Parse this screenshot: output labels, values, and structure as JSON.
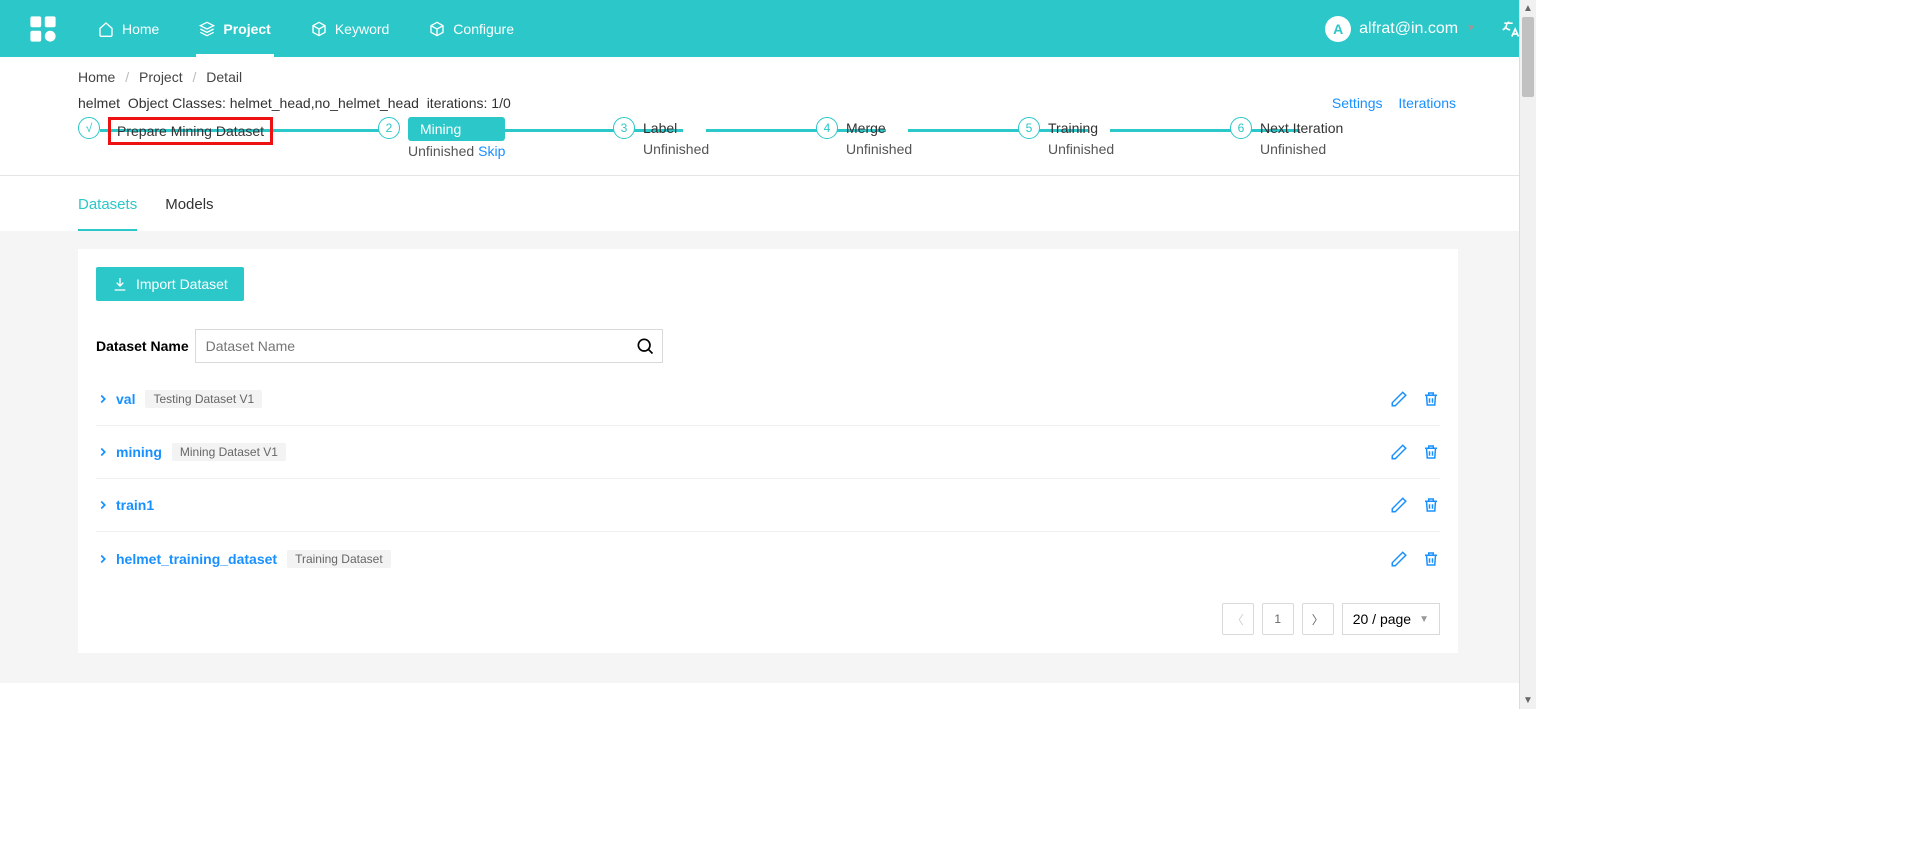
{
  "header": {
    "nav": [
      {
        "key": "home",
        "label": "Home"
      },
      {
        "key": "project",
        "label": "Project"
      },
      {
        "key": "keyword",
        "label": "Keyword"
      },
      {
        "key": "configure",
        "label": "Configure"
      }
    ],
    "user_initial": "A",
    "user_email": "alfrat@in.com"
  },
  "breadcrumb": {
    "home": "Home",
    "project": "Project",
    "detail": "Detail"
  },
  "meta": {
    "project_name": "helmet",
    "classes_label": "Object Classes:",
    "classes": "helmet_head,no_helmet_head",
    "iter_label": "iterations:",
    "iterations": "1/0",
    "settings": "Settings",
    "iterations_link": "Iterations"
  },
  "steps": [
    {
      "n": "√",
      "label": "Prepare Mining Dataset",
      "sub": "",
      "highlight": true,
      "done": true
    },
    {
      "n": "2",
      "label": "Mining",
      "sub": "Unfinished",
      "skip": "Skip",
      "badge": true
    },
    {
      "n": "3",
      "label": "Label",
      "sub": "Unfinished"
    },
    {
      "n": "4",
      "label": "Merge",
      "sub": "Unfinished"
    },
    {
      "n": "5",
      "label": "Training",
      "sub": "Unfinished"
    },
    {
      "n": "6",
      "label": "Next Iteration",
      "sub": "Unfinished"
    }
  ],
  "tabs": {
    "datasets": "Datasets",
    "models": "Models"
  },
  "import_btn": "Import Dataset",
  "search": {
    "label": "Dataset Name",
    "placeholder": "Dataset Name",
    "value": ""
  },
  "datasets": [
    {
      "name": "val",
      "tag": "Testing Dataset V1"
    },
    {
      "name": "mining",
      "tag": "Mining Dataset V1"
    },
    {
      "name": "train1",
      "tag": ""
    },
    {
      "name": "helmet_training_dataset",
      "tag": "Training Dataset"
    }
  ],
  "pager": {
    "page": "1",
    "size": "20 / page"
  }
}
